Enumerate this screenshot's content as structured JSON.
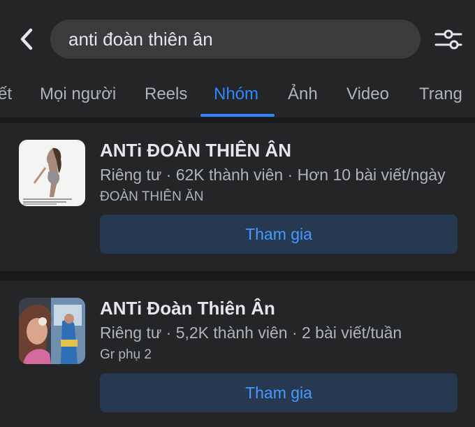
{
  "search": {
    "query": "anti đoàn thiên ân"
  },
  "icons": {
    "back": "chevron-left-icon",
    "filter": "sliders-icon"
  },
  "tabs": [
    {
      "label": "ết"
    },
    {
      "label": "Mọi người"
    },
    {
      "label": "Reels"
    },
    {
      "label": "Nhóm",
      "active": true
    },
    {
      "label": "Ảnh"
    },
    {
      "label": "Video"
    },
    {
      "label": "Trang"
    }
  ],
  "results": [
    {
      "name": "ANTi ĐOÀN THIÊN ÂN",
      "meta": "Riêng tư · 62K thành viên · Hơn 10 bài viết/ngày",
      "subtitle": "ĐOÀN THIÊN ĂN",
      "join_label": "Tham gia"
    },
    {
      "name": "ANTi Đoàn Thiên Ân",
      "meta": "Riêng tư · 5,2K thành viên · 2 bài viết/tuần",
      "subtitle": "Gr phụ 2",
      "join_label": "Tham gia"
    }
  ],
  "colors": {
    "background": "#242526",
    "separator": "#18191a",
    "accent": "#2d88ff",
    "join_button_bg": "#263951",
    "join_button_text": "#4599ff",
    "secondary_text": "#b0b3b8"
  }
}
